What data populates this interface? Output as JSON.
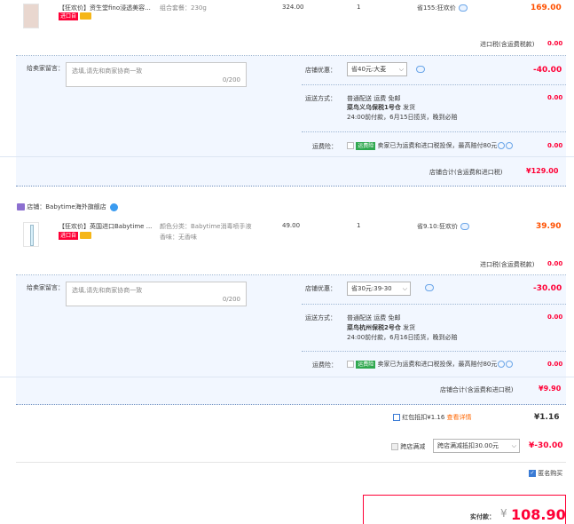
{
  "shop1": {
    "item": {
      "title": "【狂欢价】资生堂fino浸透美容...",
      "tag_import": "进口自",
      "sku": "组合套餐：230g",
      "unit_price": "324.00",
      "qty": "1",
      "discount": "省155:狂欢价",
      "total": "169.00"
    },
    "import_tax_label": "进口税(含运费税款)",
    "import_tax_value": "0.00",
    "message_label": "给卖家留言：",
    "message_placeholder": "选填,请先和商家协商一致",
    "message_count": "0/200",
    "promo_label": "店铺优惠：",
    "promo_value": "省40元:大麦",
    "promo_amount": "-40.00",
    "ship_label": "运送方式：",
    "ship_line1": "普通配送 运费 免邮",
    "ship_line2": "菜鸟义乌保税1号仓",
    "ship_line2b": "发货",
    "ship_line3": "24:00前付款，6月15日揽货，晚到必赔",
    "ship_amount": "0.00",
    "insurance_label": "运费险：",
    "insurance_badge": "运费险",
    "insurance_text": "卖家已为运费和进口税投保，最高赔付80元",
    "insurance_amount": "0.00",
    "subtotal_label": "店铺合计(含运费和进口税)",
    "subtotal_value": "¥129.00"
  },
  "shop2": {
    "shop_label": "店铺：",
    "shop_name": "Babytime海外旗舰店",
    "item": {
      "title": "【狂欢价】英国进口Babytime ...",
      "tag_import": "进口自",
      "sku_line1": "颜色分类：Babytime消毒喷手液",
      "sku_line2": "香味：无香味",
      "unit_price": "49.00",
      "qty": "1",
      "discount": "省9.10:狂欢价",
      "total": "39.90"
    },
    "import_tax_label": "进口税(含运费税款)",
    "import_tax_value": "0.00",
    "message_label": "给卖家留言：",
    "message_placeholder": "选填,请先和商家协商一致",
    "message_count": "0/200",
    "promo_label": "店铺优惠：",
    "promo_value": "省30元:39-30",
    "promo_amount": "-30.00",
    "ship_label": "运送方式：",
    "ship_line1": "普通配送 运费 免邮",
    "ship_line2": "菜鸟杭州保税2号仓",
    "ship_line2b": "发货",
    "ship_line3": "24:00前付款，6月16日揽货，晚到必赔",
    "ship_amount": "0.00",
    "insurance_label": "运费险：",
    "insurance_badge": "运费险",
    "insurance_text": "卖家已为运费和进口税投保，最高赔付80元",
    "insurance_amount": "0.00",
    "subtotal_label": "店铺合计(含运费和进口税)",
    "subtotal_value": "¥9.90"
  },
  "summary": {
    "redpacket_label": "红包抵扣¥1.16",
    "redpacket_link": "查看详情",
    "redpacket_value": "¥1.16",
    "crossshop_label": "跨店满减",
    "crossshop_select": "跨店满减抵扣30.00元",
    "crossshop_value": "¥-30.00",
    "anonymous_label": "匿名购买",
    "pay_label": "实付款：",
    "pay_currency": "¥",
    "pay_value": "108.90"
  }
}
